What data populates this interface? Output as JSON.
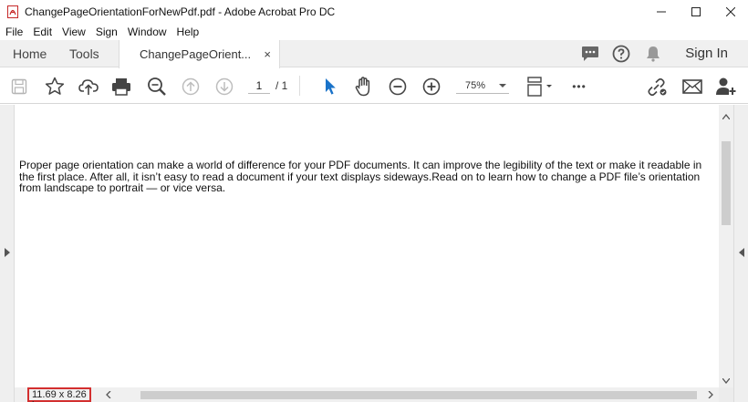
{
  "window": {
    "title": "ChangePageOrientationForNewPdf.pdf - Adobe Acrobat Pro DC",
    "controls": [
      "minimize",
      "maximize",
      "close"
    ]
  },
  "menu": [
    "File",
    "Edit",
    "View",
    "Sign",
    "Window",
    "Help"
  ],
  "tabs": {
    "home": "Home",
    "tools": "Tools",
    "document": "ChangePageOrient...",
    "close": "×"
  },
  "header_right": {
    "sign_in": "Sign In"
  },
  "toolbar": {
    "page_current": "1",
    "page_total": "/ 1",
    "zoom": "75%",
    "more": "•••"
  },
  "document": {
    "body_text": "Proper page orientation can make a world of difference for your PDF documents. It can improve the legibility of the text or make it readable in the first place. After all, it isn’t easy to read a document if your text displays sideways.Read on to learn how to change a PDF file’s orientation from landscape to portrait — or vice versa.",
    "page_size": "11.69 x 8.26 in"
  },
  "colors": {
    "select_tool": "#1a73c9",
    "highlight_box": "#d32f2f"
  }
}
